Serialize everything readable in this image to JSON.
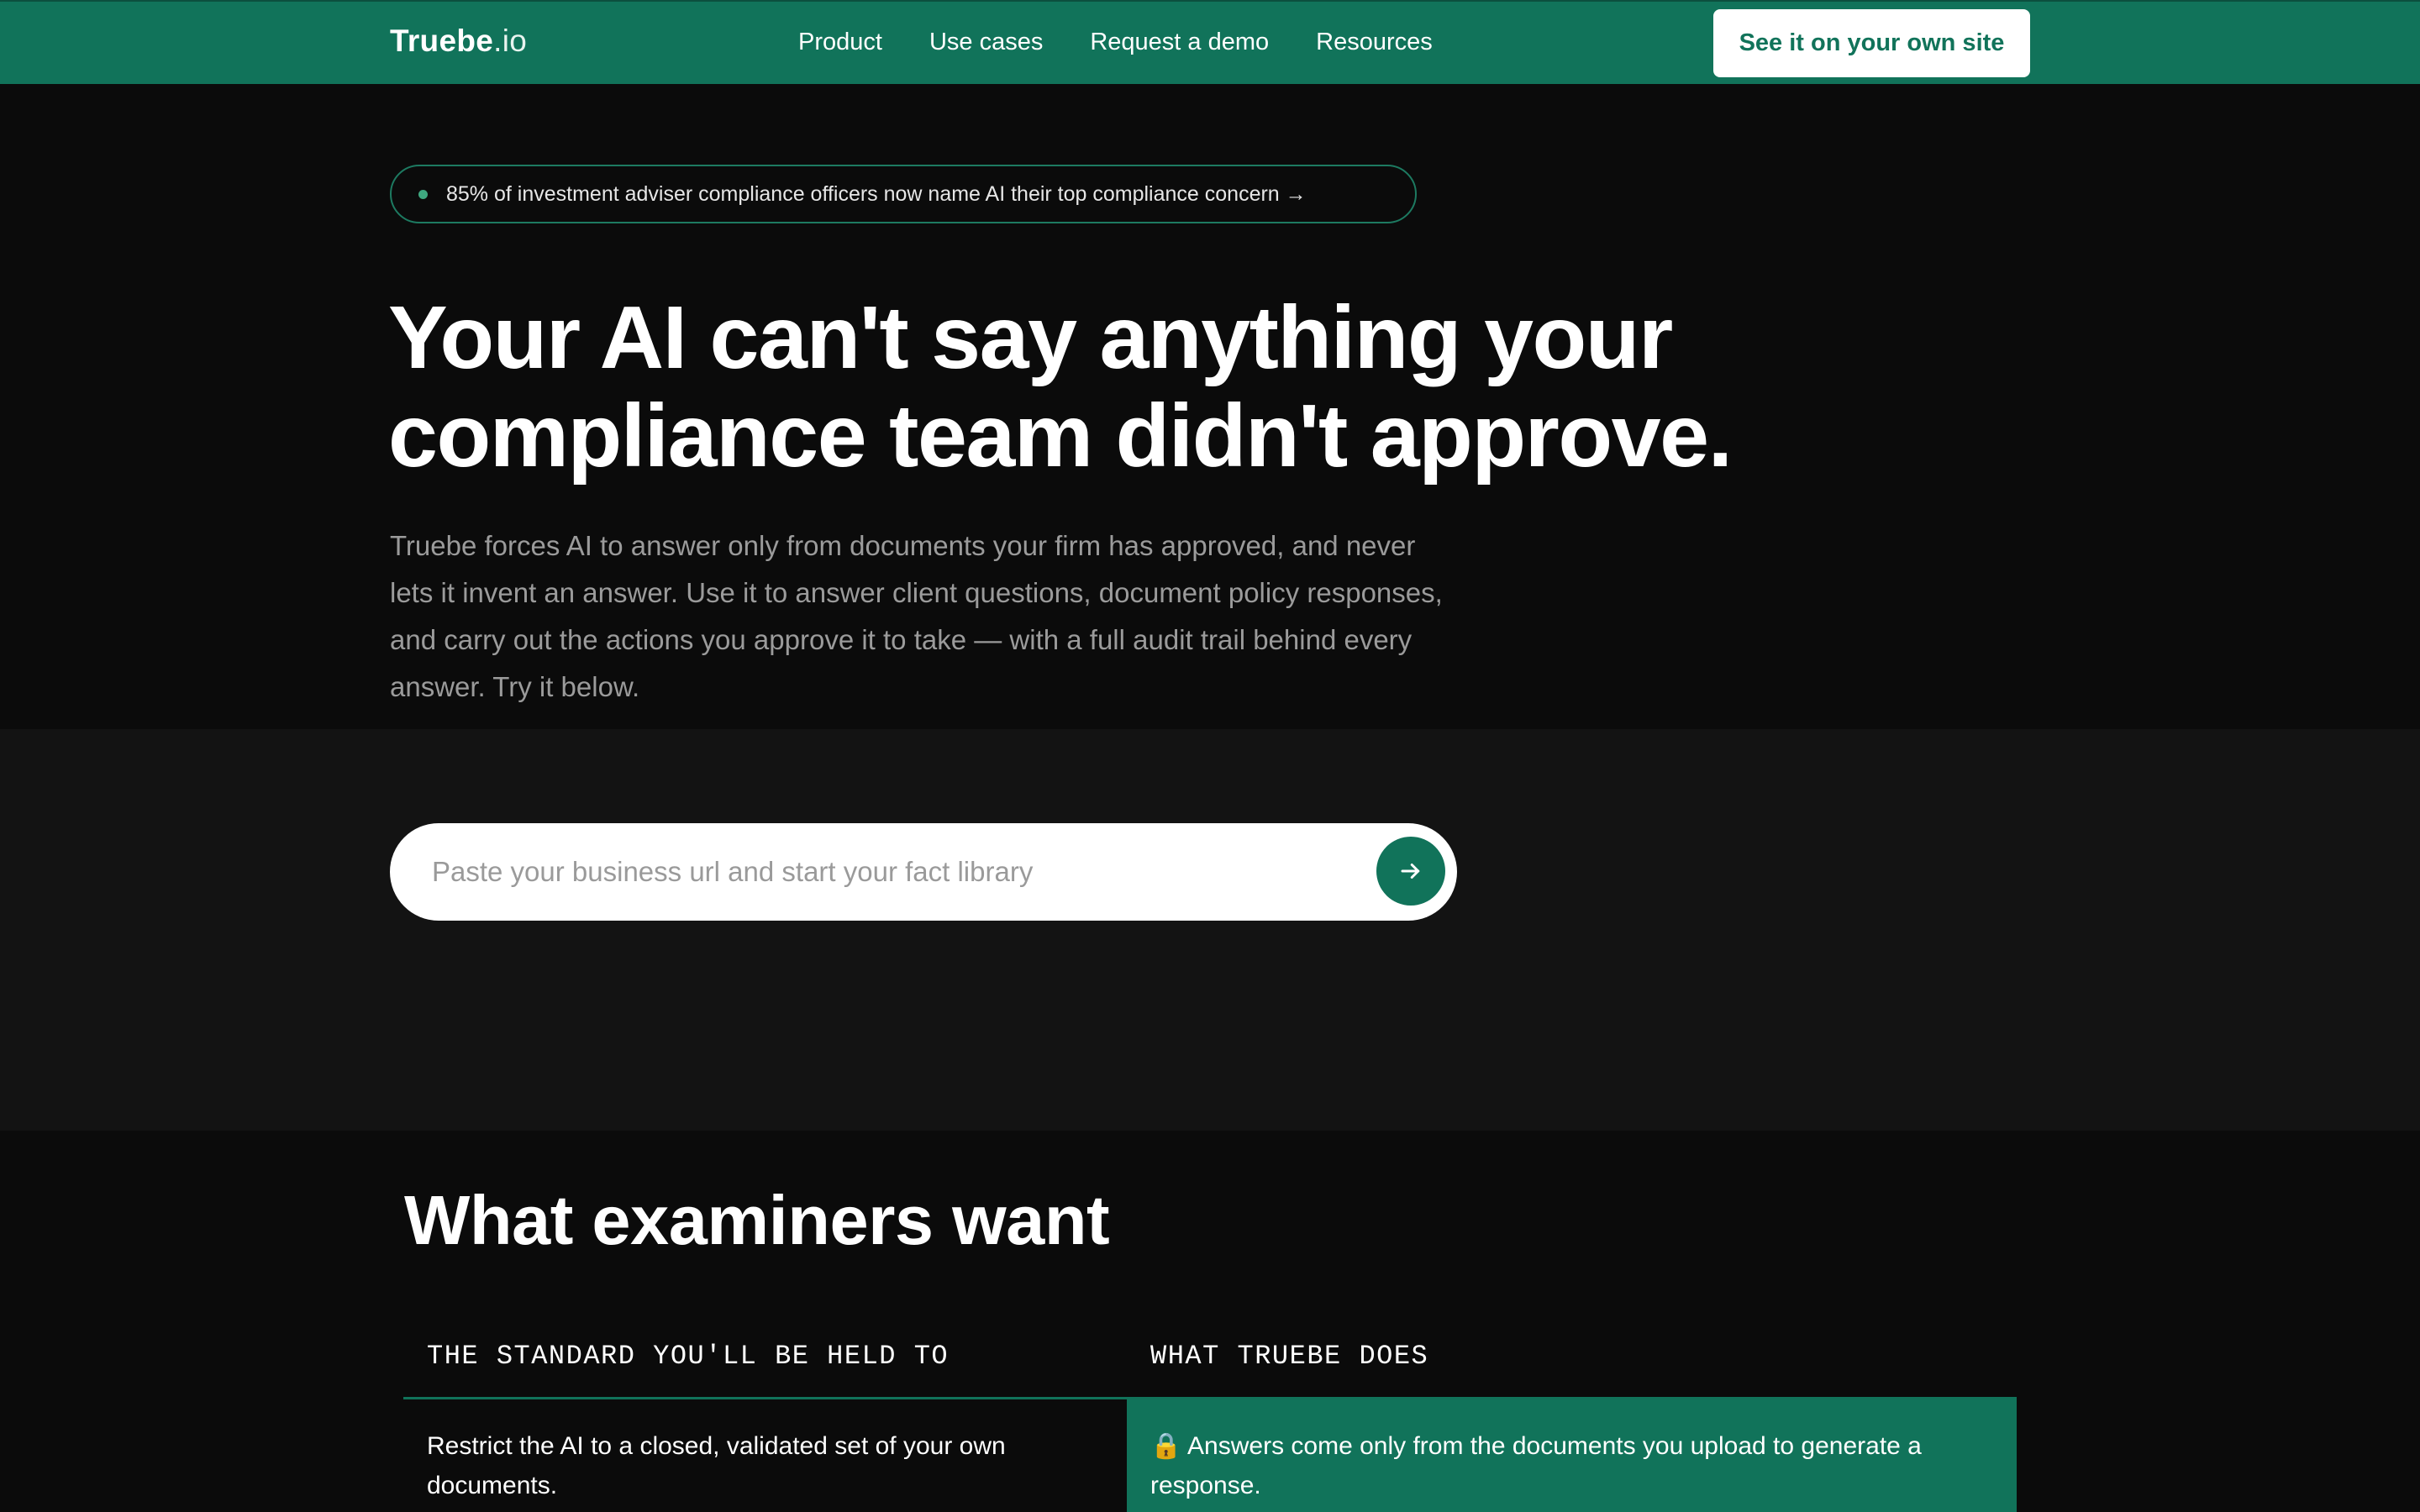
{
  "nav": {
    "logo_bold": "Truebe",
    "logo_light": ".io",
    "links": [
      "Product",
      "Use cases",
      "Request a demo",
      "Resources"
    ],
    "cta": "See it on your own site"
  },
  "hero": {
    "badge": "85% of investment adviser compliance officers now name AI their top compliance concern →",
    "headline_line1": "Your AI can't say anything your",
    "headline_line2": "compliance team didn't approve.",
    "subtext": "Truebe forces AI to answer only from documents your firm has approved, and never lets it invent an answer. Use it to answer client questions, document policy responses, and carry out the actions you approve it to take — with a full audit trail behind every answer. Try it below.",
    "search_placeholder": "Paste your business url and start your fact library",
    "submit_icon": "arrow-right-icon"
  },
  "section": {
    "title": "What examiners want",
    "col_left_header": "THE STANDARD YOU'LL BE HELD TO",
    "col_right_header": "WHAT TRUEBE DOES",
    "rows": [
      {
        "standard": "Restrict the AI to a closed, validated set of your own documents.",
        "truebe": "🔒 Answers come only from the documents you upload to generate a response."
      }
    ]
  },
  "colors": {
    "brand_green": "#11735a",
    "background": "#0b0b0b",
    "hero_lower_bg": "#131313",
    "muted_text": "#9b9b9b"
  }
}
